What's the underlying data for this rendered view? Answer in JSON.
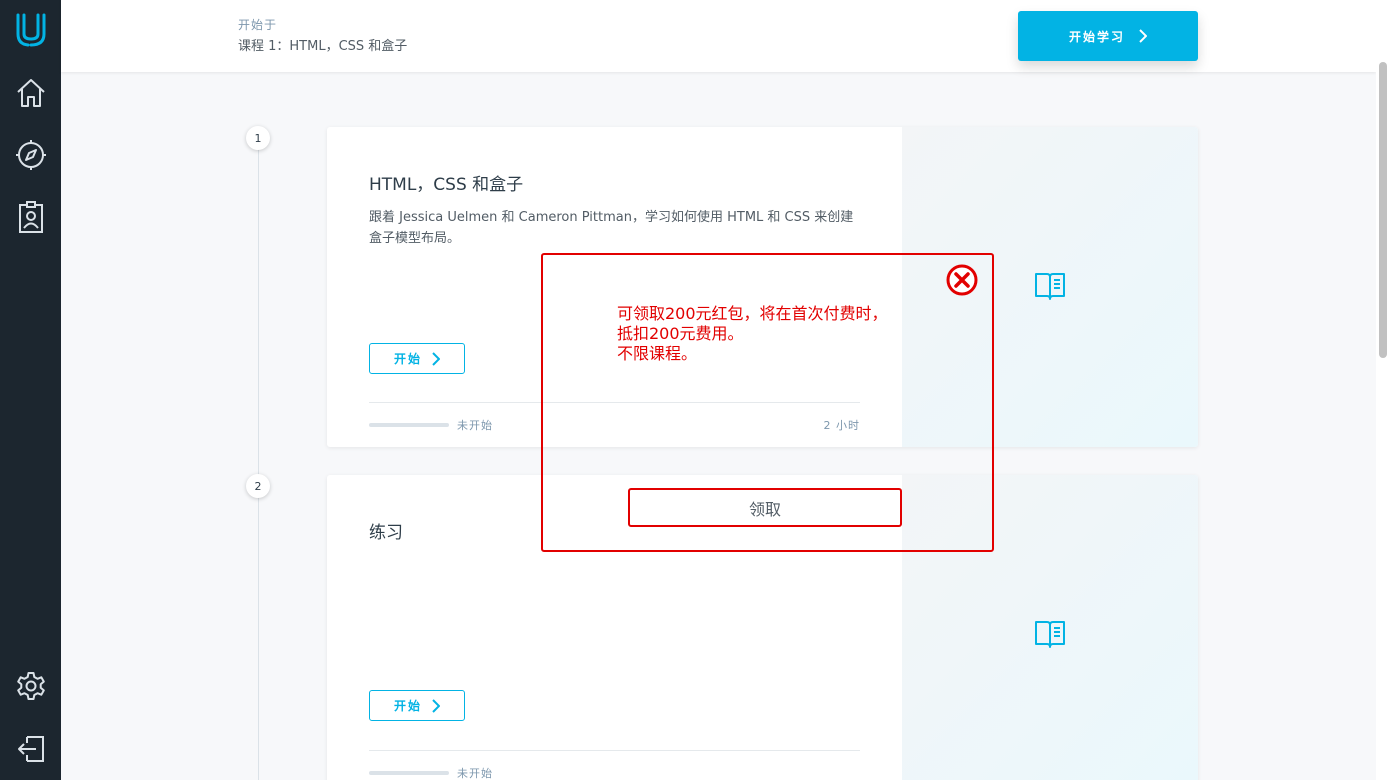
{
  "sidebar": {
    "items": [
      {
        "icon": "udacity-logo-icon"
      },
      {
        "icon": "home-icon"
      },
      {
        "icon": "compass-icon"
      },
      {
        "icon": "profile-icon"
      },
      {
        "icon": "gear-icon"
      },
      {
        "icon": "logout-icon"
      }
    ]
  },
  "header": {
    "small_label": "开始于",
    "course_label": "课程 1：HTML，CSS 和盒子",
    "start_button_label": "开始学习"
  },
  "lessons": [
    {
      "number": "1",
      "title": "HTML，CSS 和盒子",
      "description": "跟着 Jessica Uelmen 和 Cameron Pittman，学习如何使用 HTML 和 CSS 来创建盒子模型布局。",
      "button_label": "开始",
      "status": "未开始",
      "duration": "2 小时",
      "progress": 0
    },
    {
      "number": "2",
      "title": "练习",
      "description": "",
      "button_label": "开始",
      "status": "未开始",
      "duration": "",
      "progress": 0
    }
  ],
  "popup": {
    "lines": [
      "可领取200元红包，将在首次付费时，",
      "抵扣200元费用。",
      "不限课程。"
    ],
    "claim_label": "领取"
  },
  "colors": {
    "accent": "#02b3e4",
    "sidebar": "#1c262f",
    "popup_red": "#e20000"
  }
}
